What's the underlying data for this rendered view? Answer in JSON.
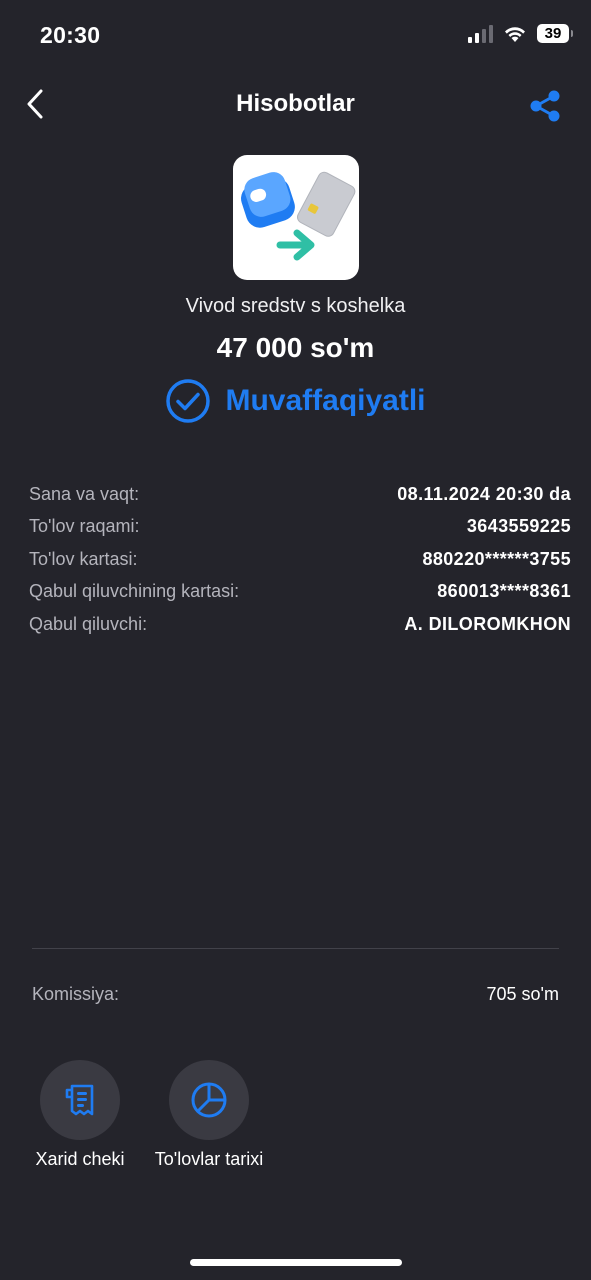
{
  "status_bar": {
    "time": "20:30",
    "battery": "39"
  },
  "nav": {
    "title": "Hisobotlar"
  },
  "transaction": {
    "service_name": "Vivod sredstv s koshelka",
    "amount": "47 000 so'm",
    "status": "Muvaffaqiyatli",
    "status_color": "#1f7cf2"
  },
  "details": [
    {
      "label": "Sana va vaqt:",
      "value": "08.11.2024 20:30 da"
    },
    {
      "label": "To'lov raqami:",
      "value": "3643559225"
    },
    {
      "label": "To'lov kartasi:",
      "value": "880220******3755"
    },
    {
      "label": "Qabul qiluvchining kartasi:",
      "value": "860013****8361"
    },
    {
      "label": "Qabul qiluvchi:",
      "value": "A. DILOROMKHON"
    }
  ],
  "commission": {
    "label": "Komissiya:",
    "value": "705 so'm"
  },
  "actions": {
    "receipt_label": "Xarid cheki",
    "history_label": "To'lovlar tarixi"
  },
  "colors": {
    "background": "#24242b",
    "accent": "#1f7cf2",
    "arrow": "#2fbfa5"
  }
}
